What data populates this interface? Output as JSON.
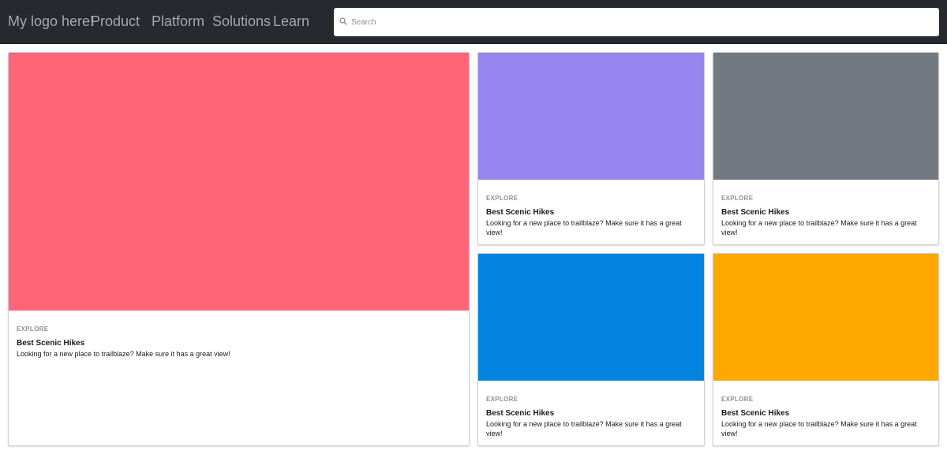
{
  "header": {
    "logo": "My logo here!",
    "nav": [
      "Product",
      "Platform",
      "Solutions",
      "Learn"
    ],
    "search_placeholder": "Search"
  },
  "cards": [
    {
      "eyebrow": "EXPLORE",
      "title": "Best Scenic Hikes",
      "description": "Looking for a new place to trailblaze? Make sure it has a great view!",
      "color": "#ff6577"
    },
    {
      "eyebrow": "EXPLORE",
      "title": "Best Scenic Hikes",
      "description": "Looking for a new place to trailblaze? Make sure it has a great view!",
      "color": "#9785f0"
    },
    {
      "eyebrow": "EXPLORE",
      "title": "Best Scenic Hikes",
      "description": "Looking for a new place to trailblaze? Make sure it has a great view!",
      "color": "#737982"
    },
    {
      "eyebrow": "EXPLORE",
      "title": "Best Scenic Hikes",
      "description": "Looking for a new place to trailblaze? Make sure it has a great view!",
      "color": "#0284e0"
    },
    {
      "eyebrow": "EXPLORE",
      "title": "Best Scenic Hikes",
      "description": "Looking for a new place to trailblaze? Make sure it has a great view!",
      "color": "#ffa800"
    }
  ]
}
